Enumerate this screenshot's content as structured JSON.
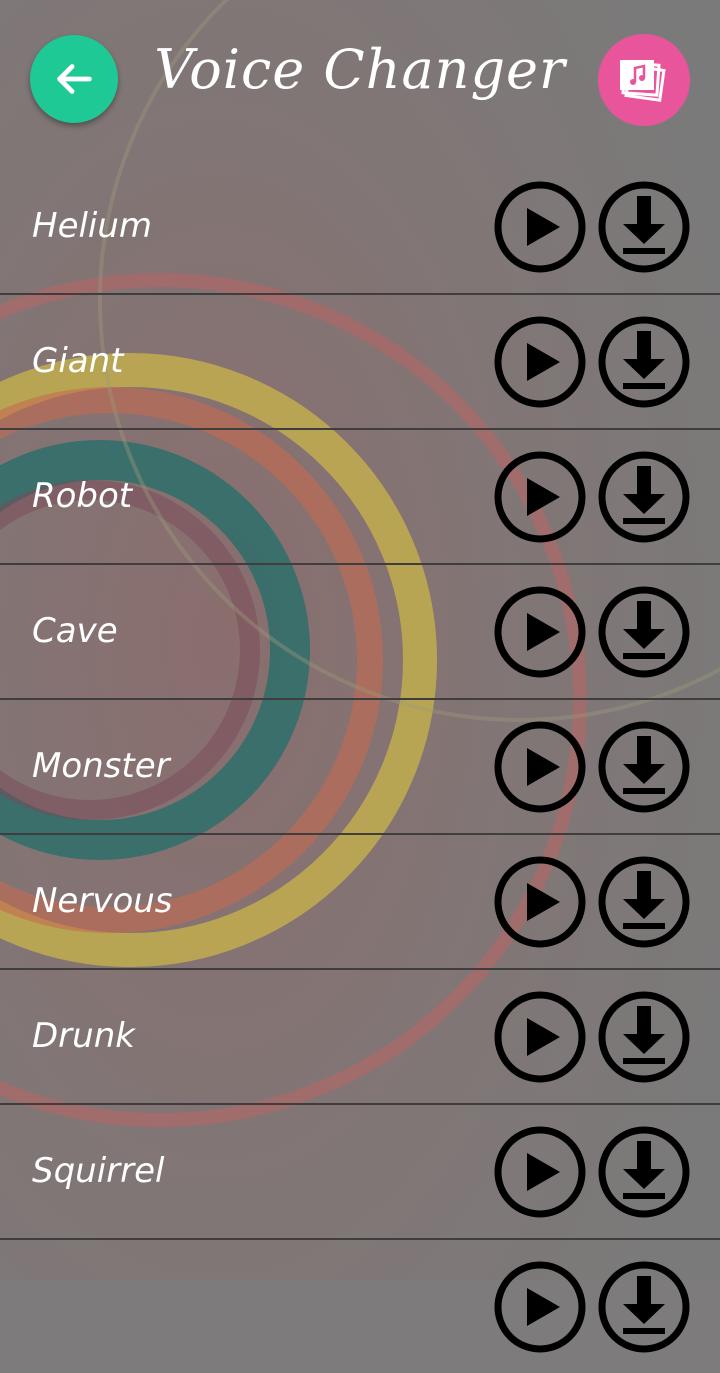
{
  "header": {
    "title": "Voice Changer",
    "back_icon": "arrow-left-icon",
    "gallery_icon": "music-gallery-icon"
  },
  "effects": [
    {
      "label": "Helium"
    },
    {
      "label": "Giant"
    },
    {
      "label": "Robot"
    },
    {
      "label": "Cave"
    },
    {
      "label": "Monster"
    },
    {
      "label": "Nervous"
    },
    {
      "label": "Drunk"
    },
    {
      "label": "Squirrel"
    },
    {
      "label": ""
    }
  ],
  "colors": {
    "back_button": "#1fc996",
    "gallery_button": "#e8559a",
    "icon_stroke": "#000000",
    "text": "#ffffff"
  }
}
